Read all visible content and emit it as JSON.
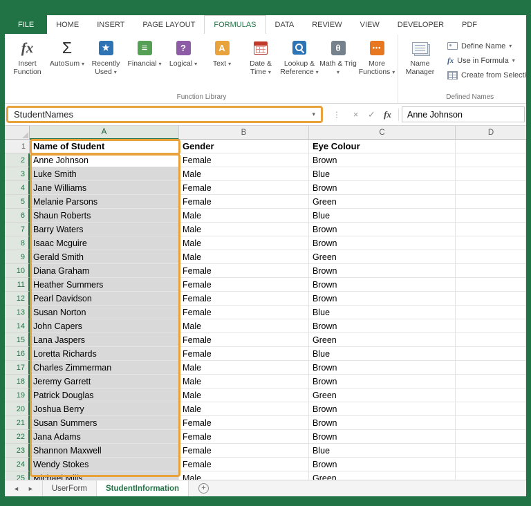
{
  "colors": {
    "accent_green": "#217346",
    "highlight_orange": "#E9A13B",
    "selection_gray": "#D9D9D9"
  },
  "icons": {
    "dropdown": "▾",
    "fx": "fx",
    "autosum": "Σ",
    "star": "★",
    "financial": "≡",
    "question": "?",
    "letter_a": "A",
    "theta": "θ",
    "ellipsis": "•••",
    "cancel": "×",
    "enter": "✓",
    "vdots": "⋮",
    "nav_left": "◄",
    "nav_right": "►",
    "add": "+"
  },
  "ribbon_tabs": [
    {
      "label": "FILE",
      "style": "file"
    },
    {
      "label": "HOME"
    },
    {
      "label": "INSERT"
    },
    {
      "label": "PAGE LAYOUT"
    },
    {
      "label": "FORMULAS",
      "active": true
    },
    {
      "label": "DATA"
    },
    {
      "label": "REVIEW"
    },
    {
      "label": "VIEW"
    },
    {
      "label": "DEVELOPER"
    },
    {
      "label": "PDF"
    }
  ],
  "ribbon": {
    "function_library": {
      "group_label": "Function Library",
      "buttons": [
        {
          "label": "Insert Function"
        },
        {
          "label": "AutoSum",
          "dropdown": true
        },
        {
          "label": "Recently Used",
          "dropdown": true
        },
        {
          "label": "Financial",
          "dropdown": true
        },
        {
          "label": "Logical",
          "dropdown": true
        },
        {
          "label": "Text",
          "dropdown": true
        },
        {
          "label": "Date & Time",
          "dropdown": true
        },
        {
          "label": "Lookup & Reference",
          "dropdown": true
        },
        {
          "label": "Math & Trig",
          "dropdown": true
        },
        {
          "label": "More Functions",
          "dropdown": true
        }
      ]
    },
    "defined_names": {
      "group_label": "Defined Names",
      "name_manager_label": "Name Manager",
      "items": [
        {
          "label": "Define Name",
          "dropdown": true
        },
        {
          "label": "Use in Formula",
          "dropdown": true
        },
        {
          "label": "Create from Selection"
        }
      ]
    }
  },
  "formula_bar": {
    "name_box": "StudentNames",
    "cell_value": "Anne Johnson"
  },
  "grid": {
    "column_letters": [
      "A",
      "B",
      "C",
      "D"
    ],
    "selected_column": "A",
    "header_row": {
      "num": 1,
      "cells": [
        "Name of Student",
        "Gender",
        "Eye Colour"
      ]
    },
    "rows": [
      {
        "num": 2,
        "cells": [
          "Anne Johnson",
          "Female",
          "Brown"
        ],
        "active": true
      },
      {
        "num": 3,
        "cells": [
          "Luke Smith",
          "Male",
          "Blue"
        ]
      },
      {
        "num": 4,
        "cells": [
          "Jane Williams",
          "Female",
          "Brown"
        ]
      },
      {
        "num": 5,
        "cells": [
          "Melanie Parsons",
          "Female",
          "Green"
        ]
      },
      {
        "num": 6,
        "cells": [
          "Shaun Roberts",
          "Male",
          "Blue"
        ]
      },
      {
        "num": 7,
        "cells": [
          "Barry Waters",
          "Male",
          "Brown"
        ]
      },
      {
        "num": 8,
        "cells": [
          "Isaac Mcguire",
          "Male",
          "Brown"
        ]
      },
      {
        "num": 9,
        "cells": [
          "Gerald Smith",
          "Male",
          "Green"
        ]
      },
      {
        "num": 10,
        "cells": [
          "Diana Graham",
          "Female",
          "Brown"
        ]
      },
      {
        "num": 11,
        "cells": [
          "Heather Summers",
          "Female",
          "Brown"
        ]
      },
      {
        "num": 12,
        "cells": [
          "Pearl Davidson",
          "Female",
          "Brown"
        ]
      },
      {
        "num": 13,
        "cells": [
          "Susan Norton",
          "Female",
          "Blue"
        ]
      },
      {
        "num": 14,
        "cells": [
          "John Capers",
          "Male",
          "Brown"
        ]
      },
      {
        "num": 15,
        "cells": [
          "Lana Jaspers",
          "Female",
          "Green"
        ]
      },
      {
        "num": 16,
        "cells": [
          "Loretta Richards",
          "Female",
          "Blue"
        ]
      },
      {
        "num": 17,
        "cells": [
          "Charles Zimmerman",
          "Male",
          "Brown"
        ]
      },
      {
        "num": 18,
        "cells": [
          "Jeremy Garrett",
          "Male",
          "Brown"
        ]
      },
      {
        "num": 19,
        "cells": [
          "Patrick Douglas",
          "Male",
          "Green"
        ]
      },
      {
        "num": 20,
        "cells": [
          "Joshua Berry",
          "Male",
          "Brown"
        ]
      },
      {
        "num": 21,
        "cells": [
          "Susan Summers",
          "Female",
          "Brown"
        ]
      },
      {
        "num": 22,
        "cells": [
          "Jana Adams",
          "Female",
          "Brown"
        ]
      },
      {
        "num": 23,
        "cells": [
          "Shannon Maxwell",
          "Female",
          "Blue"
        ]
      },
      {
        "num": 24,
        "cells": [
          "Wendy Stokes",
          "Female",
          "Brown"
        ]
      },
      {
        "num": 25,
        "cells": [
          "Michael Mills",
          "Male",
          "Green"
        ]
      }
    ]
  },
  "sheet_bar": {
    "tabs": [
      {
        "label": "UserForm"
      },
      {
        "label": "StudentInformation",
        "active": true
      }
    ]
  }
}
